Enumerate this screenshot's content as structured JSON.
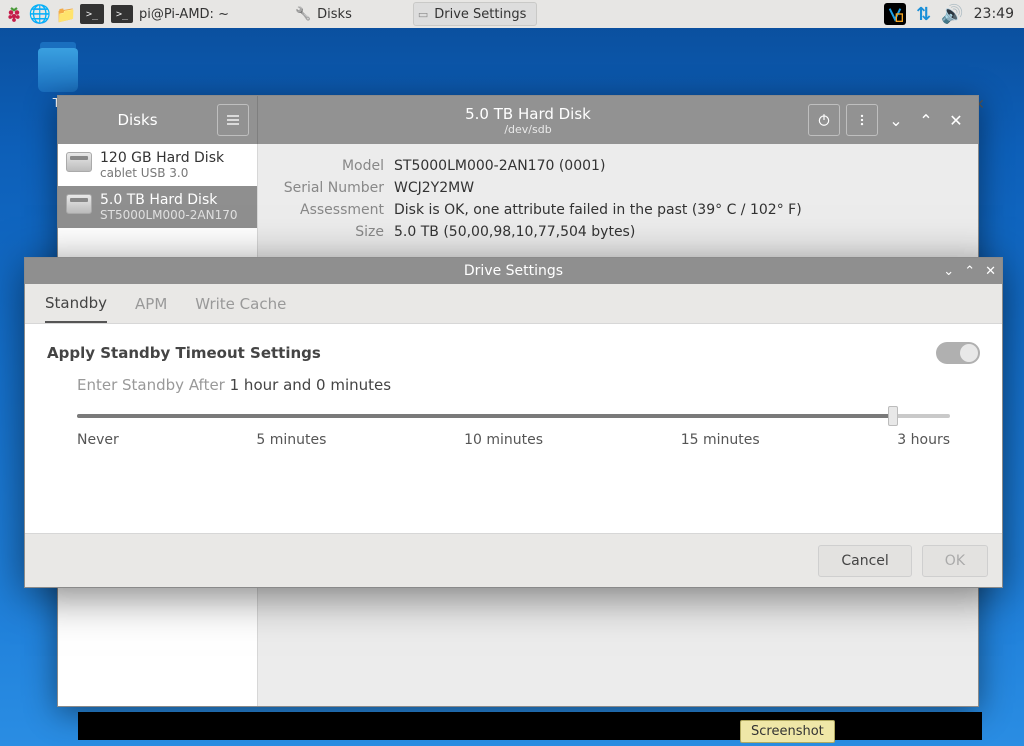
{
  "taskbar": {
    "terminal_task": "pi@Pi-AMD: ~",
    "disks_task": "Disks",
    "settings_task": "Drive Settings",
    "clock": "23:49"
  },
  "desktop": {
    "trash_label": "Tr"
  },
  "disks_window": {
    "app_title": "Disks",
    "header_title": "5.0 TB Hard Disk",
    "header_subtitle": "/dev/sdb",
    "sidebar": {
      "drives": [
        {
          "title": "120 GB Hard Disk",
          "subtitle": "cablet USB 3.0"
        },
        {
          "title": "5.0 TB Hard Disk",
          "subtitle": "ST5000LM000-2AN170"
        }
      ]
    },
    "details": {
      "model_label": "Model",
      "model_value": "ST5000LM000-2AN170 (0001)",
      "serial_label": "Serial Number",
      "serial_value": "WCJ2Y2MW",
      "assessment_label": "Assessment",
      "assessment_value": "Disk is OK, one attribute failed in the past (39° C / 102° F)",
      "size_label": "Size",
      "size_value": "5.0 TB (50,00,98,10,77,504 bytes)"
    }
  },
  "settings_window": {
    "title": "Drive Settings",
    "tabs": {
      "standby": "Standby",
      "apm": "APM",
      "write_cache": "Write Cache"
    },
    "section_title": "Apply Standby Timeout Settings",
    "standby_label": "Enter Standby After",
    "standby_value": "1 hour and 0 minutes",
    "slider": {
      "ticks": [
        "Never",
        "5 minutes",
        "10 minutes",
        "15 minutes",
        "3 hours"
      ]
    },
    "buttons": {
      "cancel": "Cancel",
      "ok": "OK"
    }
  },
  "tooltip": "Screenshot"
}
